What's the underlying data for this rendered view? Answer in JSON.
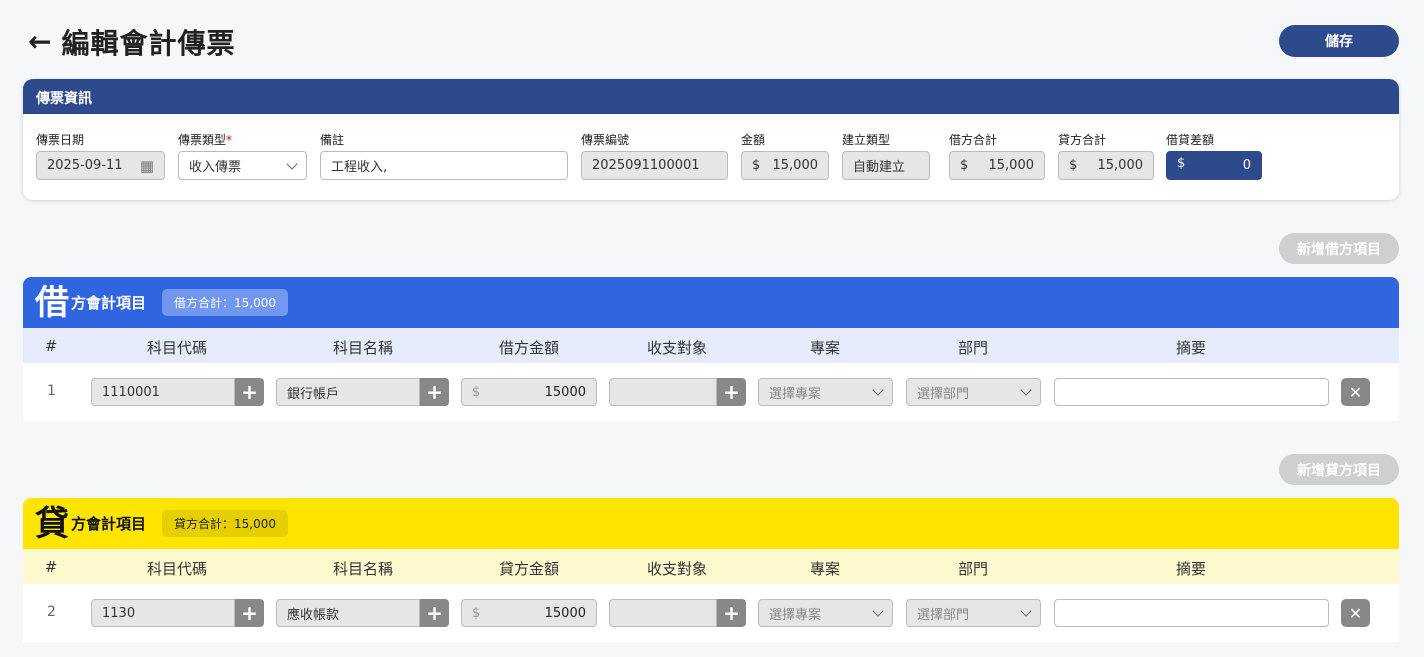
{
  "header": {
    "back_icon": "←",
    "title": "編輯會計傳票",
    "save_label": "儲存"
  },
  "info": {
    "heading": "傳票資訊",
    "date_label": "傳票日期",
    "date_value": "2025-09-11",
    "type_label": "傳票類型",
    "type_required": "*",
    "type_value": "收入傳票",
    "note_label": "備註",
    "note_value": "工程收入,",
    "number_label": "傳票編號",
    "number_value": "2025091100001",
    "amount_label": "金額",
    "amount_value": "15,000",
    "create_label": "建立類型",
    "create_value": "自動建立",
    "debit_total_label": "借方合計",
    "debit_total_value": "15,000",
    "credit_total_label": "貸方合計",
    "credit_total_value": "15,000",
    "diff_label": "借貸差額",
    "diff_value": "0",
    "currency": "$"
  },
  "debit": {
    "add_label": "新增借方項目",
    "big_char": "借",
    "title": "方會計項目",
    "badge": "借方合計：15,000",
    "columns": [
      "#",
      "科目代碼",
      "科目名稱",
      "借方金額",
      "收支對象",
      "專案",
      "部門",
      "摘要"
    ],
    "row": {
      "no": "1",
      "code": "1110001",
      "name": "銀行帳戶",
      "amount": "15000",
      "project_placeholder": "選擇專案",
      "dept_placeholder": "選擇部門"
    }
  },
  "credit": {
    "add_label": "新增貸方項目",
    "big_char": "貸",
    "title": "方會計項目",
    "badge": "貸方合計：15,000",
    "columns": [
      "#",
      "科目代碼",
      "科目名稱",
      "貸方金額",
      "收支對象",
      "專案",
      "部門",
      "摘要"
    ],
    "row": {
      "no": "2",
      "code": "1130",
      "name": "應收帳款",
      "amount": "15000",
      "project_placeholder": "選擇專案",
      "dept_placeholder": "選擇部門"
    }
  },
  "icons": {
    "plus": "+",
    "delete": "✕",
    "calendar": "📅"
  },
  "colors": {
    "primary": "#2d4a8c",
    "debit": "#2f66e0",
    "credit": "#ffe500"
  }
}
